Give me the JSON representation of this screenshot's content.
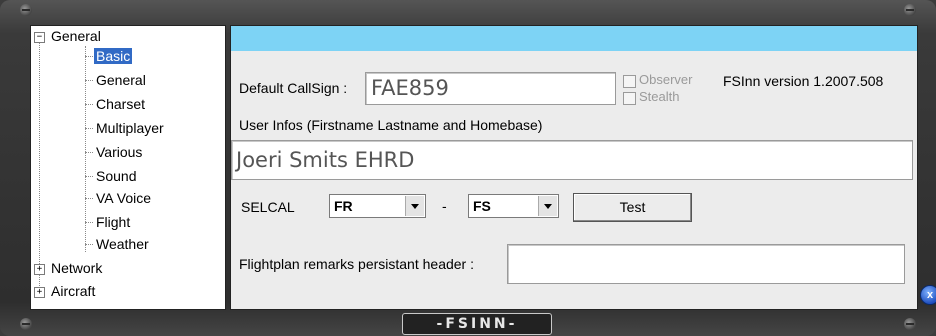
{
  "tree": {
    "general": {
      "label": "General",
      "expander": "−"
    },
    "children": [
      {
        "label": "Basic"
      },
      {
        "label": "General"
      },
      {
        "label": "Charset"
      },
      {
        "label": "Multiplayer"
      },
      {
        "label": "Various"
      },
      {
        "label": "Sound"
      },
      {
        "label": "VA Voice"
      },
      {
        "label": "Flight"
      },
      {
        "label": "Weather"
      }
    ],
    "network": {
      "label": "Network",
      "expander": "+"
    },
    "aircraft": {
      "label": "Aircraft",
      "expander": "+"
    }
  },
  "basic": {
    "callsign_label": "Default CallSign :",
    "callsign_value": "FAE859",
    "observer_label": "Observer",
    "stealth_label": "Stealth",
    "version_text": "FSInn version 1.2007.508",
    "userinfo_label": "User Infos (Firstname Lastname and Homebase)",
    "userinfo_value": "Joeri Smits EHRD",
    "selcal_label": "SELCAL",
    "selcal_1": "FR",
    "selcal_sep": "-",
    "selcal_2": "FS",
    "test_label": "Test",
    "flightplan_label": "Flightplan remarks persistant header :",
    "flightplan_value": ""
  },
  "footer": {
    "logo_text": "-FSINN-",
    "close_glyph": "x"
  },
  "colors": {
    "accent_bar": "#7dd3f5",
    "selection": "#316ac5",
    "frame": "#343434"
  }
}
